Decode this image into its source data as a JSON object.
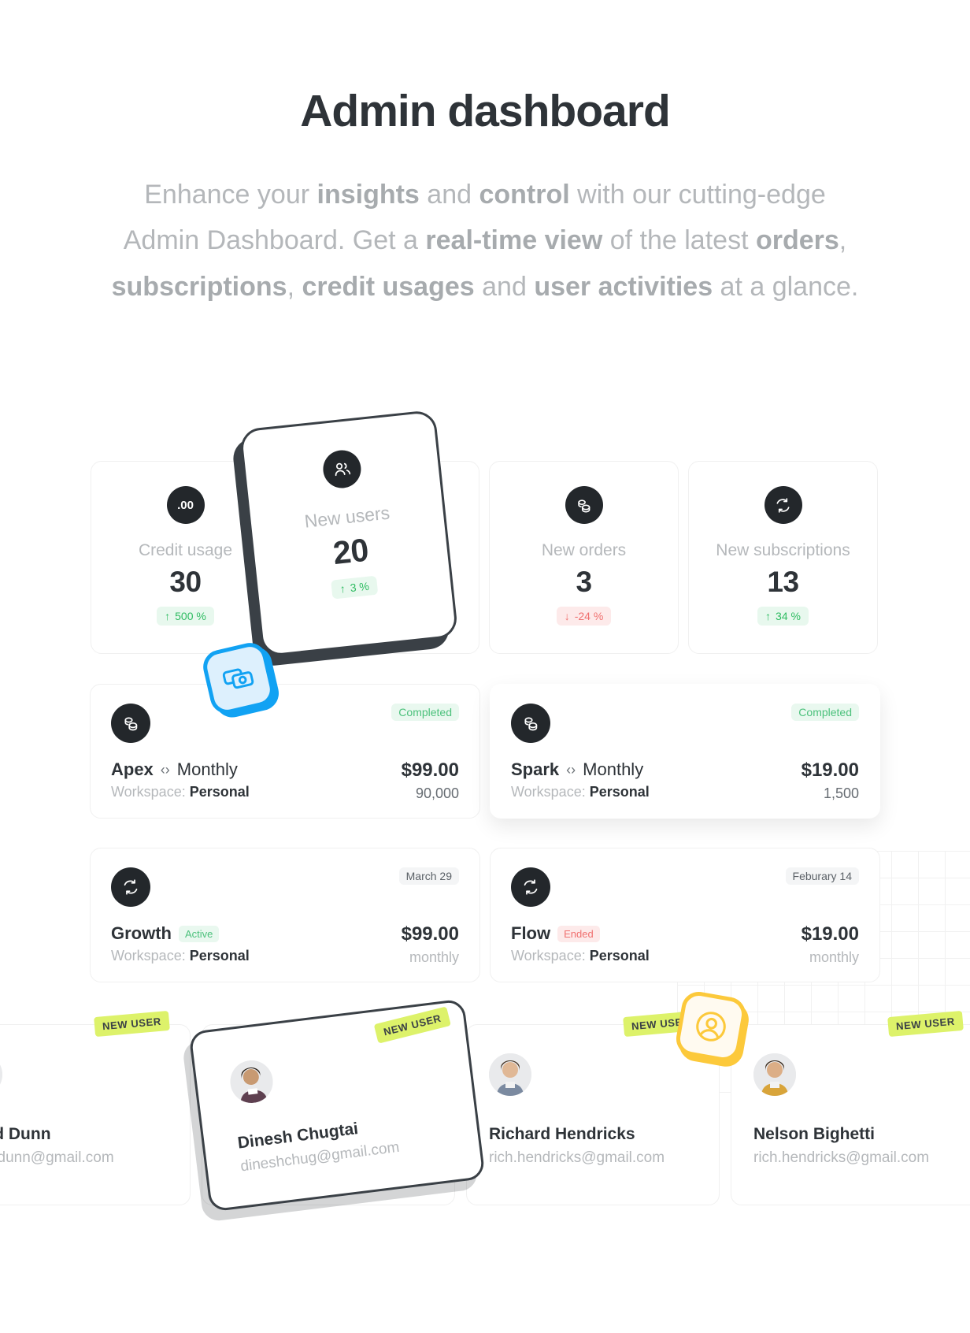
{
  "hero": {
    "title": "Admin dashboard",
    "subtitle_parts": [
      {
        "t": "Enhance your ",
        "b": false
      },
      {
        "t": "insights",
        "b": true
      },
      {
        "t": " and ",
        "b": false
      },
      {
        "t": "control",
        "b": true
      },
      {
        "t": " with our cutting-edge Admin Dashboard. Get a ",
        "b": false
      },
      {
        "t": "real-time view",
        "b": true
      },
      {
        "t": " of the latest ",
        "b": false
      },
      {
        "t": "orders",
        "b": true
      },
      {
        "t": ", ",
        "b": false
      },
      {
        "t": "subscriptions",
        "b": true
      },
      {
        "t": ", ",
        "b": false
      },
      {
        "t": "credit usages",
        "b": true
      },
      {
        "t": " and ",
        "b": false
      },
      {
        "t": "user activities",
        "b": true
      },
      {
        "t": " at a glance.",
        "b": false
      }
    ]
  },
  "stats": [
    {
      "icon": "decimal-zero-icon",
      "icon_text": ".00",
      "label": "Credit usage",
      "value": "30",
      "delta": "500 %",
      "direction": "up",
      "arrow": "↑"
    },
    {
      "icon": "users-icon",
      "icon_text": "",
      "label": "New users",
      "value": "20",
      "delta": "3 %",
      "direction": "up",
      "arrow": "↑"
    },
    {
      "icon": "coins-icon",
      "icon_text": "",
      "label": "New orders",
      "value": "3",
      "delta": "-24 %",
      "direction": "down",
      "arrow": "↓"
    },
    {
      "icon": "sync-icon",
      "icon_text": "",
      "label": "New subscriptions",
      "value": "13",
      "delta": "34 %",
      "direction": "up",
      "arrow": "↑"
    }
  ],
  "orders": [
    {
      "icon": "coins-icon",
      "status": "Completed",
      "name": "Apex",
      "separator": "‹›",
      "plan": "Monthly",
      "workspace_label": "Workspace:",
      "workspace": "Personal",
      "price": "$99.00",
      "credits": "90,000"
    },
    {
      "icon": "coins-icon",
      "status": "Completed",
      "name": "Spark",
      "separator": "‹›",
      "plan": "Monthly",
      "workspace_label": "Workspace:",
      "workspace": "Personal",
      "price": "$19.00",
      "credits": "1,500"
    }
  ],
  "subscriptions": [
    {
      "icon": "sync-icon",
      "date": "March 29",
      "name": "Growth",
      "state": "Active",
      "state_kind": "active",
      "workspace_label": "Workspace:",
      "workspace": "Personal",
      "price": "$99.00",
      "cycle": "monthly"
    },
    {
      "icon": "sync-icon",
      "date": "Feburary 14",
      "name": "Flow",
      "state": "Ended",
      "state_kind": "ended",
      "workspace_label": "Workspace:",
      "workspace": "Personal",
      "price": "$19.00",
      "cycle": "monthly"
    }
  ],
  "users": [
    {
      "name": "Jared Dunn",
      "email": "jared.dunn@gmail.com",
      "tag": "NEW USER",
      "avatar_hair": "#8a6a46",
      "avatar_shirt": "#c6b190",
      "avatar_skin": "#e8c6a8"
    },
    {
      "name": "Dinesh Chugtai",
      "email": "dineshchug@gmail.com",
      "tag": "NEW USER",
      "avatar_hair": "#2a2118",
      "avatar_shirt": "#5e4050",
      "avatar_skin": "#c89a72"
    },
    {
      "name": "Richard Hendricks",
      "email": "rich.hendricks@gmail.com",
      "tag": "NEW USER",
      "avatar_hair": "#4a3828",
      "avatar_shirt": "#7b8aa0",
      "avatar_skin": "#e0b896"
    },
    {
      "name": "Nelson Bighetti",
      "email": "rich.hendricks@gmail.com",
      "tag": "NEW USER",
      "avatar_hair": "#3a2a1c",
      "avatar_shirt": "#d8a43a",
      "avatar_skin": "#dcae86"
    }
  ],
  "floating_icons": [
    {
      "name": "banknotes-icon",
      "color": "#11a2f3",
      "bg": "#ddf0fd"
    },
    {
      "name": "user-circle-icon",
      "color": "#fcc93b",
      "bg": "#fffaf0"
    }
  ],
  "colors": {
    "dark": "#23272b",
    "green": "#2fbc62",
    "red": "#f0706f",
    "blue": "#11a2f3",
    "yellow": "#fcc93b",
    "lime": "#ddf26a"
  }
}
